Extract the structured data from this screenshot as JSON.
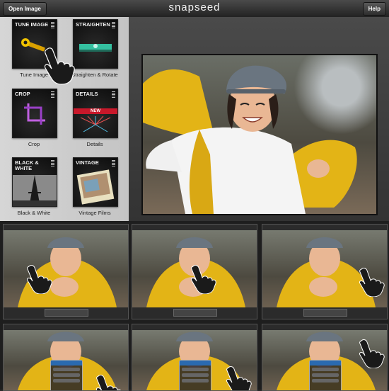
{
  "app": {
    "title": "snapseed",
    "open_button": "Open Image",
    "help_button": "Help"
  },
  "tools": [
    {
      "tile_label": "TUNE IMAGE",
      "caption": "Tune Image",
      "icon": "wrench-icon"
    },
    {
      "tile_label": "STRAIGHTEN",
      "caption": "Straighten & Rotate",
      "icon": "level-icon"
    },
    {
      "tile_label": "CROP",
      "caption": "Crop",
      "icon": "crop-icon"
    },
    {
      "tile_label": "DETAILS",
      "caption": "Details",
      "icon": "sparkle-icon",
      "badge": "NEW"
    },
    {
      "tile_label": "BLACK & WHITE",
      "caption": "Black & White",
      "icon": "eiffel-tower-icon"
    },
    {
      "tile_label": "VINTAGE",
      "caption": "Vintage Films",
      "icon": "photo-icon"
    }
  ],
  "colors": {
    "scarf_yellow": "#e2b21a",
    "new_badge": "#c8182a",
    "hat_gray": "#6a7580"
  }
}
